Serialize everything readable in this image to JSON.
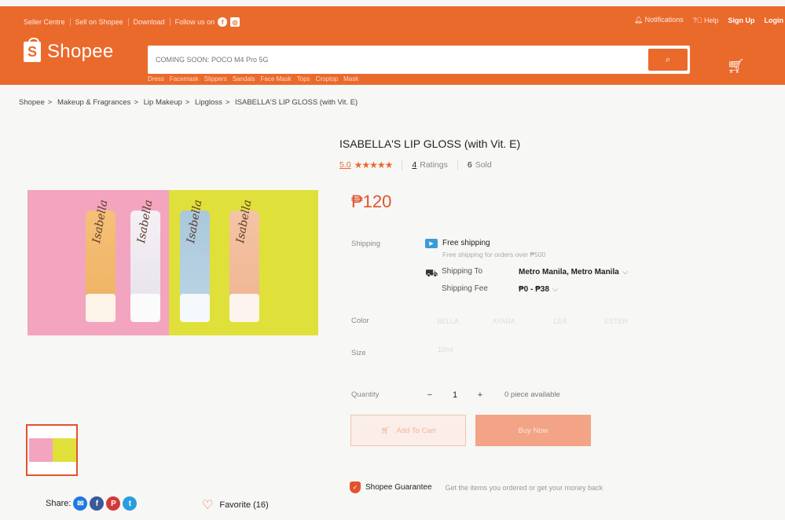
{
  "header": {
    "seller_centre": "Seller Centre",
    "sell_on": "Sell on Shopee",
    "download": "Download",
    "follow": "Follow us on",
    "notifications": "Notifications",
    "help": "Help",
    "signup": "Sign Up",
    "login": "Login",
    "logo": "Shopee",
    "search_placeholder": "COMING SOON: POCO M4 Pro 5G",
    "hints": [
      "Dress",
      "Facemask",
      "Slippers",
      "Sandals",
      "Face Mask",
      "Tops",
      "Croptop",
      "Mask"
    ]
  },
  "breadcrumb": [
    "Shopee",
    "Makeup & Fragrances",
    "Lip Makeup",
    "Lipgloss",
    "ISABELLA'S LIP GLOSS (with Vit. E)"
  ],
  "product": {
    "title": "ISABELLA'S LIP GLOSS (with Vit. E)",
    "rating": "5.0",
    "stars": "★★★★★",
    "ratings_count": "4",
    "ratings_label": "Ratings",
    "sold_count": "6",
    "sold_label": "Sold",
    "price": "₱120",
    "image_brand": "Isabella"
  },
  "shipping": {
    "label": "Shipping",
    "free": "Free shipping",
    "free_sub": "Free shipping for orders over ₱500",
    "to_label": "Shipping To",
    "to_value": "Metro Manila, Metro Manila",
    "fee_label": "Shipping Fee",
    "fee_value": "₱0 - ₱38"
  },
  "variants": {
    "color_label": "Color",
    "colors": [
      "BELLA",
      "AYANA",
      "LEA",
      "ESTER"
    ],
    "size_label": "Size",
    "sizes": [
      "10ml"
    ]
  },
  "quantity": {
    "label": "Quantity",
    "minus": "−",
    "value": "1",
    "plus": "+",
    "available": "0 piece available"
  },
  "actions": {
    "add_to_cart": "Add To Cart",
    "buy_now": "Buy Now"
  },
  "guarantee": {
    "title": "Shopee Guarantee",
    "sub": "Get the items you ordered or get your money back"
  },
  "share": {
    "label": "Share:",
    "favorite": "Favorite (16)"
  },
  "colors": {
    "brand": "#ea6a2c",
    "price": "#e2532d",
    "pink": "#f3a4bf",
    "yellow": "#dfe03a"
  }
}
